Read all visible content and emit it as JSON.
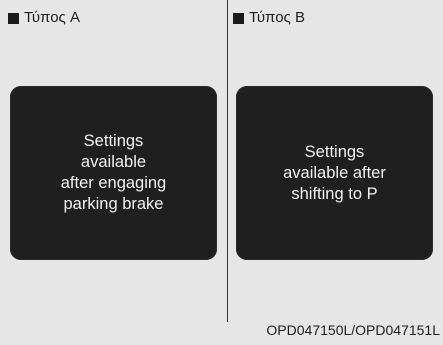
{
  "colors": {
    "background": "#e6e6e6",
    "screen": "#1f1f1f",
    "screen_text": "#f2f2f2"
  },
  "type_a": {
    "label": "Τύπος A",
    "message_lines": [
      "Settings",
      "available",
      "after engaging",
      "parking brake"
    ]
  },
  "type_b": {
    "label": "Τύπος B",
    "message_lines": [
      "Settings",
      "available after",
      "shifting to P"
    ]
  },
  "figure_code": "OPD047150L/OPD047151L"
}
